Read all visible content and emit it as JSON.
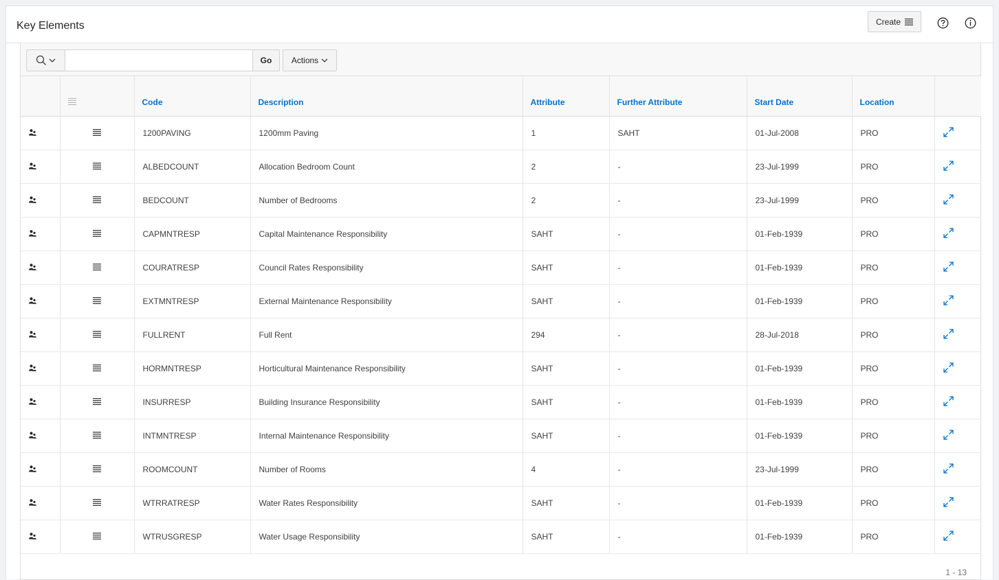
{
  "region": {
    "title": "Key Elements",
    "create_label": "Create",
    "help_icon": "help-circle-icon",
    "info_icon": "info-circle-icon"
  },
  "toolbar": {
    "search_value": "",
    "search_placeholder": "",
    "go_label": "Go",
    "actions_label": "Actions"
  },
  "table": {
    "columns": [
      "Code",
      "Description",
      "Attribute",
      "Further Attribute",
      "Start Date",
      "Location"
    ],
    "rows": [
      {
        "code": "1200PAVING",
        "description": "1200mm Paving",
        "attribute": "1",
        "further": "SAHT",
        "start": "01-Jul-2008",
        "location": "PRO"
      },
      {
        "code": "ALBEDCOUNT",
        "description": "Allocation Bedroom Count",
        "attribute": "2",
        "further": "-",
        "start": "23-Jul-1999",
        "location": "PRO"
      },
      {
        "code": "BEDCOUNT",
        "description": "Number of Bedrooms",
        "attribute": "2",
        "further": "-",
        "start": "23-Jul-1999",
        "location": "PRO"
      },
      {
        "code": "CAPMNTRESP",
        "description": "Capital Maintenance Responsibility",
        "attribute": "SAHT",
        "further": "-",
        "start": "01-Feb-1939",
        "location": "PRO"
      },
      {
        "code": "COURATRESP",
        "description": "Council Rates Responsibility",
        "attribute": "SAHT",
        "further": "-",
        "start": "01-Feb-1939",
        "location": "PRO"
      },
      {
        "code": "EXTMNTRESP",
        "description": "External Maintenance Responsibility",
        "attribute": "SAHT",
        "further": "-",
        "start": "01-Feb-1939",
        "location": "PRO"
      },
      {
        "code": "FULLRENT",
        "description": "Full Rent",
        "attribute": "294",
        "further": "-",
        "start": "28-Jul-2018",
        "location": "PRO"
      },
      {
        "code": "HORMNTRESP",
        "description": "Horticultural Maintenance Responsibility",
        "attribute": "SAHT",
        "further": "-",
        "start": "01-Feb-1939",
        "location": "PRO"
      },
      {
        "code": "INSURRESP",
        "description": "Building Insurance Responsibility",
        "attribute": "SAHT",
        "further": "-",
        "start": "01-Feb-1939",
        "location": "PRO"
      },
      {
        "code": "INTMNTRESP",
        "description": "Internal Maintenance Responsibility",
        "attribute": "SAHT",
        "further": "-",
        "start": "01-Feb-1939",
        "location": "PRO"
      },
      {
        "code": "ROOMCOUNT",
        "description": "Number of Rooms",
        "attribute": "4",
        "further": "-",
        "start": "23-Jul-1999",
        "location": "PRO"
      },
      {
        "code": "WTRRATRESP",
        "description": "Water Rates Responsibility",
        "attribute": "SAHT",
        "further": "-",
        "start": "01-Feb-1939",
        "location": "PRO"
      },
      {
        "code": "WTRUSGRESP",
        "description": "Water Usage Responsibility",
        "attribute": "SAHT",
        "further": "-",
        "start": "01-Feb-1939",
        "location": "PRO"
      }
    ]
  },
  "pagination": "1 - 13",
  "colors": {
    "link": "#0572ce",
    "text": "#404040"
  }
}
